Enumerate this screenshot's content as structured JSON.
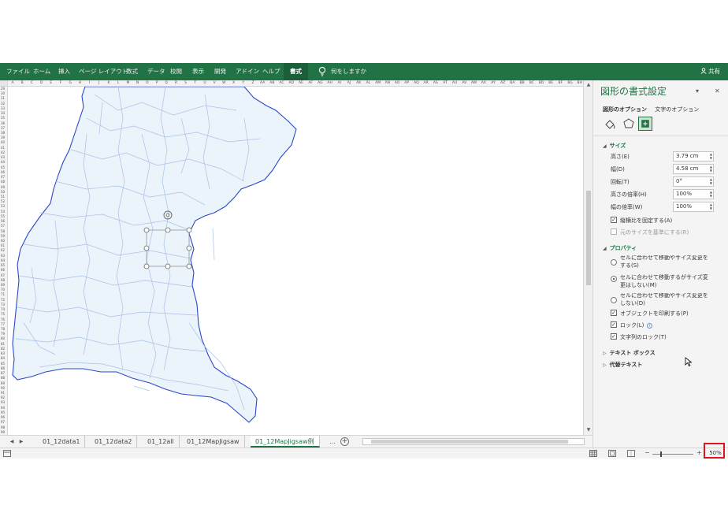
{
  "ribbon": {
    "tabs": [
      "ファイル",
      "ホーム",
      "挿入",
      "ページ レイアウト",
      "数式",
      "データ",
      "校閲",
      "表示",
      "開発",
      "アドイン",
      "ヘルプ",
      "書式"
    ],
    "active_tab": "書式",
    "tell_me": "何をしますか",
    "share": "共有"
  },
  "sheet": {
    "columns": [
      "A",
      "B",
      "C",
      "D",
      "E",
      "F",
      "G",
      "H",
      "I",
      "J",
      "K",
      "L",
      "M",
      "N",
      "O",
      "P",
      "Q",
      "R",
      "S",
      "T",
      "U",
      "V",
      "W",
      "X",
      "Y",
      "Z",
      "AA",
      "AB",
      "AC",
      "AD",
      "AE",
      "AF",
      "AG",
      "AH",
      "AI",
      "AJ",
      "AK",
      "AL",
      "AM",
      "AN",
      "AO",
      "AP",
      "AQ",
      "AR",
      "AS",
      "AT",
      "AU",
      "AV",
      "AW",
      "AX",
      "AY",
      "AZ",
      "BA",
      "BB",
      "BC",
      "BD",
      "BE",
      "BF",
      "BG",
      "BH"
    ],
    "first_row": 29,
    "last_row": 99,
    "tabs": [
      "01_12data1",
      "01_12data2",
      "01_12all",
      "01_12MapJigsaw",
      "01_12MapJigsaw例"
    ],
    "active_tab": "01_12MapJigsaw例",
    "more": "..."
  },
  "status": {
    "zoom": "50%"
  },
  "pane": {
    "title": "図形の書式設定",
    "options": [
      "図形のオプション",
      "文字のオプション"
    ],
    "active_option": "図形のオプション",
    "size_section": "サイズ",
    "fields": [
      {
        "label": "高さ(E)",
        "value": "3.79 cm"
      },
      {
        "label": "幅(D)",
        "value": "4.58 cm"
      },
      {
        "label": "回転(T)",
        "value": "0°"
      },
      {
        "label": "高さの倍率(H)",
        "value": "100%"
      },
      {
        "label": "幅の倍率(W)",
        "value": "100%"
      }
    ],
    "lock_aspect": "縦横比を固定する(A)",
    "relative_original": "元のサイズを基準にする(R)",
    "props_section": "プロパティ",
    "radio1": "セルに合わせて移動やサイズ変更をする(S)",
    "radio2": "セルに合わせて移動するがサイズ変更はしない(M)",
    "radio3": "セルに合わせて移動やサイズ変更をしない(D)",
    "print_obj": "オブジェクトを印刷する(P)",
    "lock": "ロック(L)",
    "lock_text": "文字列のロック(T)",
    "textbox_section": "テキスト ボックス",
    "alt_text_section": "代替テキスト"
  },
  "colors": {
    "excel_green": "#217346",
    "map_fill": "#ebf3fb",
    "map_border": "#2b48c8",
    "map_lines": "#a9c2e6",
    "highlight": "#e0141e"
  }
}
